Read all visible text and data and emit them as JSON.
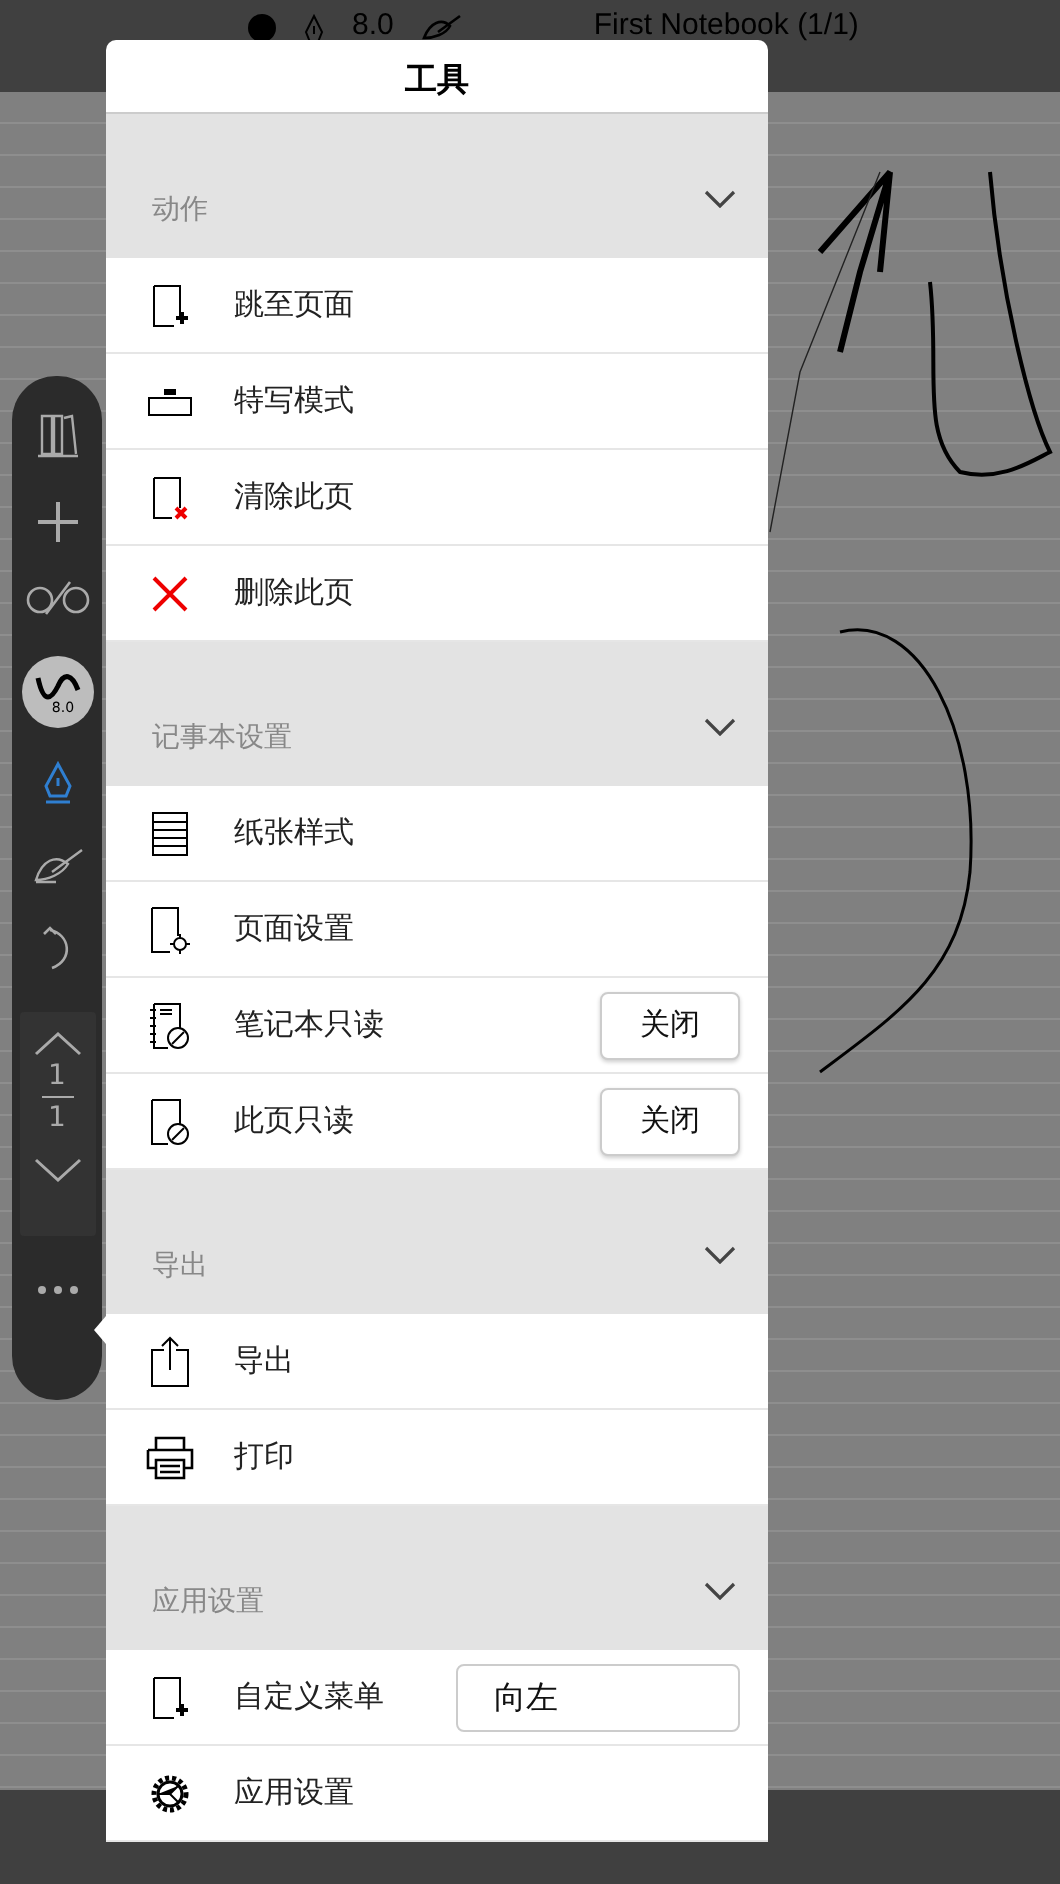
{
  "status_bar": {
    "pen_size": "8.0",
    "title": "First Notebook (1/1)"
  },
  "toolbar": {
    "brush_size": "8.0",
    "page_current": "1",
    "page_total": "1"
  },
  "panel": {
    "title": "工具",
    "sections": [
      {
        "title": "动作",
        "expanded": true,
        "items": [
          {
            "label": "跳至页面"
          },
          {
            "label": "特写模式"
          },
          {
            "label": "清除此页"
          },
          {
            "label": "删除此页"
          }
        ]
      },
      {
        "title": "记事本设置",
        "expanded": true,
        "items": [
          {
            "label": "纸张样式"
          },
          {
            "label": "页面设置"
          },
          {
            "label": "笔记本只读",
            "control": {
              "kind": "button",
              "label": "关闭"
            }
          },
          {
            "label": "此页只读",
            "control": {
              "kind": "button",
              "label": "关闭"
            }
          }
        ]
      },
      {
        "title": "导出",
        "expanded": true,
        "items": [
          {
            "label": "导出"
          },
          {
            "label": "打印"
          }
        ]
      },
      {
        "title": "应用设置",
        "expanded": true,
        "items": [
          {
            "label": "自定义菜单",
            "control": {
              "kind": "field",
              "value": "向左"
            }
          },
          {
            "label": "应用设置"
          }
        ]
      }
    ]
  }
}
